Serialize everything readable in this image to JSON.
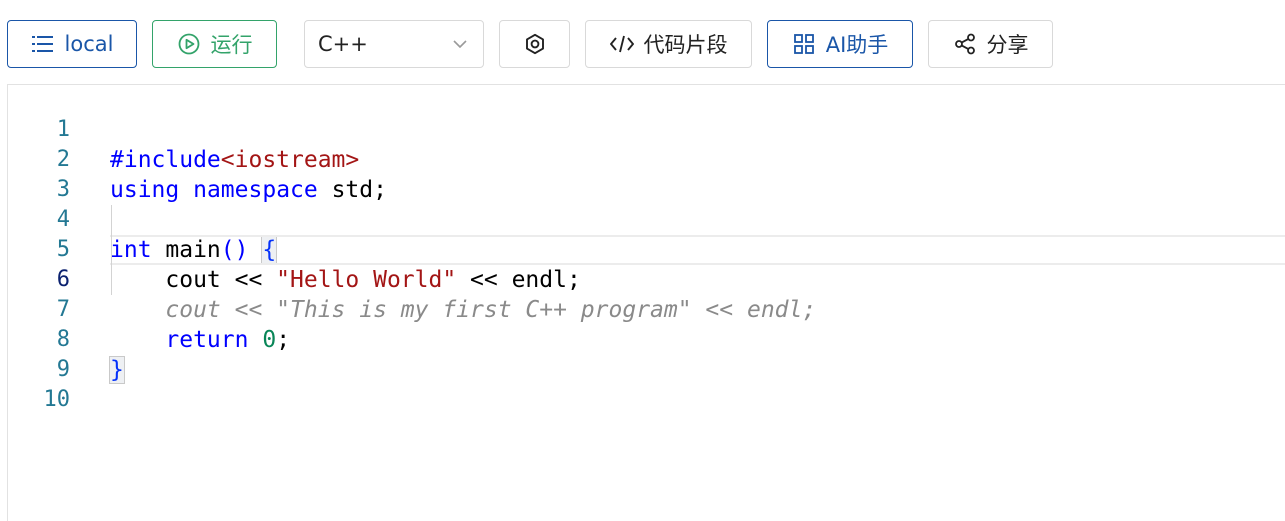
{
  "toolbar": {
    "local_label": "local",
    "run_label": "运行",
    "language_selected": "C++",
    "snippet_label": "代码片段",
    "ai_label": "AI助手",
    "share_label": "分享"
  },
  "colors": {
    "primary": "#1a56a8",
    "run_green": "#33a36a",
    "keyword": "#0000ff",
    "string": "#a31515",
    "number": "#098658",
    "line_number": "#237893"
  },
  "editor": {
    "line_numbers": [
      "1",
      "2",
      "3",
      "4",
      "5",
      "6",
      "7",
      "8",
      "9",
      "10"
    ],
    "current_line": 6,
    "lines": {
      "l1": {
        "directive": "#include",
        "header": "<iostream>"
      },
      "l2": {
        "kw1": "using",
        "kw2": "namespace",
        "rest": " std;"
      },
      "l4": {
        "kw": "int",
        "rest": " main",
        "paren": "()",
        "space": " ",
        "brace": "{"
      },
      "l5": {
        "indent": "    ",
        "a": "cout << ",
        "str": "\"Hello World\"",
        "b": " << endl;"
      },
      "l6": {
        "indent": "    ",
        "ghost": "cout << \"This is my first C++ program\" << endl;"
      },
      "l7": {
        "indent": "    ",
        "kw": "return",
        "space": " ",
        "num": "0",
        "end": ";"
      },
      "l8": {
        "brace": "}"
      }
    }
  }
}
